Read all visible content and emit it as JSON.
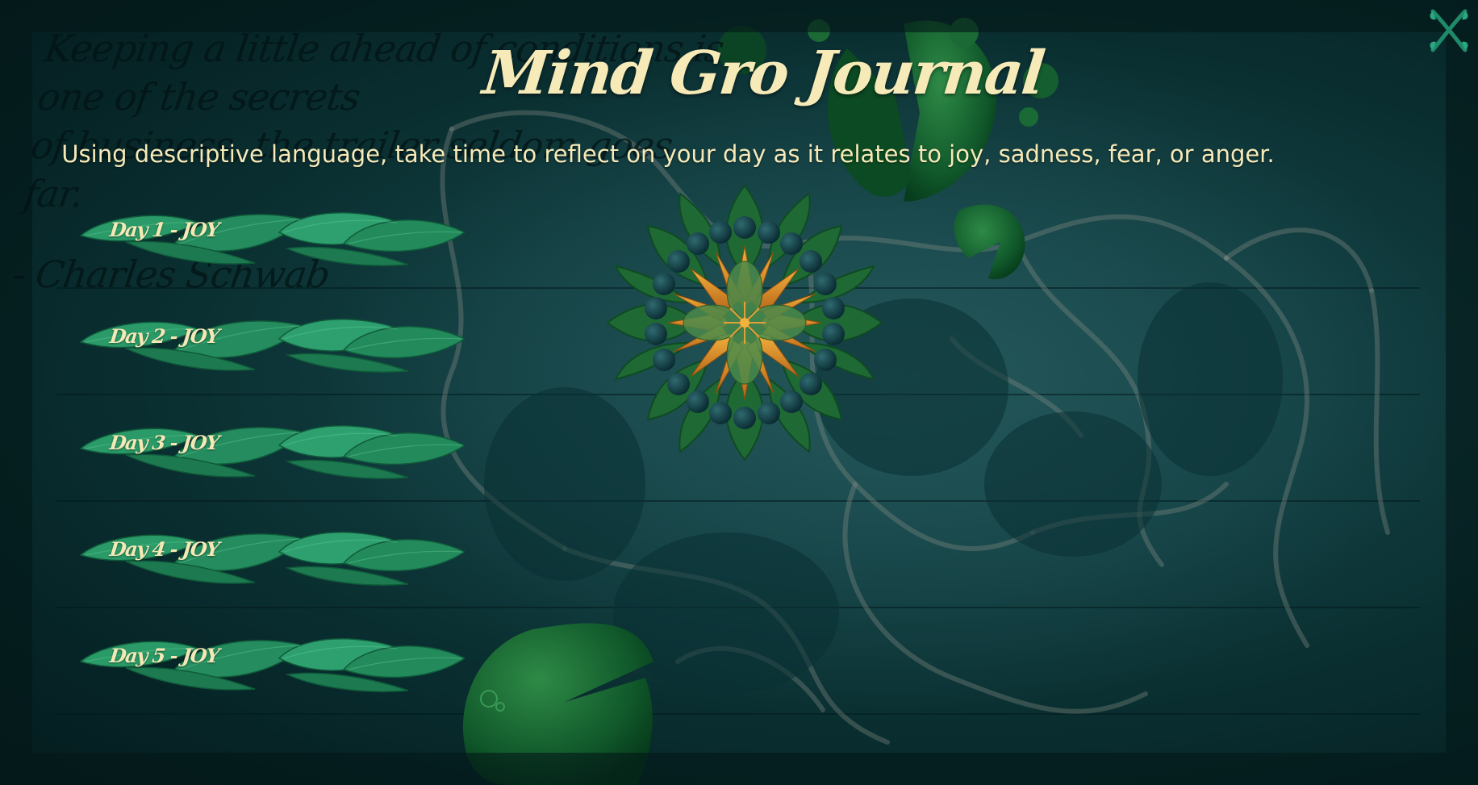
{
  "quote": {
    "line1": "Keeping a little ahead of conditions is one of the secrets",
    "line2": "of business, the trailer seldom goes far.",
    "author": "- Charles Schwab"
  },
  "title": "Mind Gro Journal",
  "instruction": "Using descriptive language, take time to reflect on your day as it relates to joy, sadness, fear, or anger.",
  "close_icon": "close-vine-icon",
  "days": [
    {
      "label": "Day 1 - JOY"
    },
    {
      "label": "Day 2 - JOY"
    },
    {
      "label": "Day 3 - JOY"
    },
    {
      "label": "Day 4 - JOY"
    },
    {
      "label": "Day 5 - JOY"
    }
  ],
  "colors": {
    "text_cream": "#f6eab8",
    "leaf_green": "#2a9a68",
    "background": "#0b3133",
    "flower_orange": "#e39a2a"
  }
}
